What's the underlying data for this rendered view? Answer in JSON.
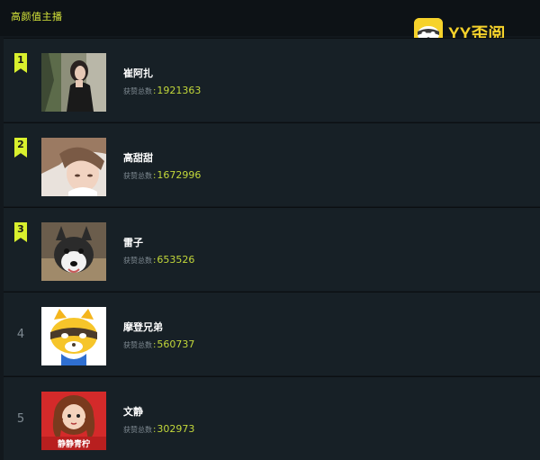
{
  "board": {
    "title": "高颜值主播"
  },
  "brand": {
    "name": "YY歪阅",
    "icon": "raccoon-logo-icon",
    "color": "#f6d22b"
  },
  "accent": "#d9f02d",
  "count_label": "获赞总数",
  "entries": [
    {
      "rank": "1",
      "name": "崔阿扎",
      "count": "1921363",
      "avatar": "woman-portrait-photo"
    },
    {
      "rank": "2",
      "name": "高甜甜",
      "count": "1672996",
      "avatar": "woman-closeup-photo"
    },
    {
      "rank": "3",
      "name": "雷子",
      "count": "653526",
      "avatar": "husky-dog-photo"
    },
    {
      "rank": "4",
      "name": "摩登兄弟",
      "count": "560737",
      "avatar": "raccoon-mascot-avatar"
    },
    {
      "rank": "5",
      "name": "文静",
      "count": "302973",
      "avatar": "cartoon-girl-avatar"
    }
  ],
  "avatar_caption_5": "静静青柠"
}
